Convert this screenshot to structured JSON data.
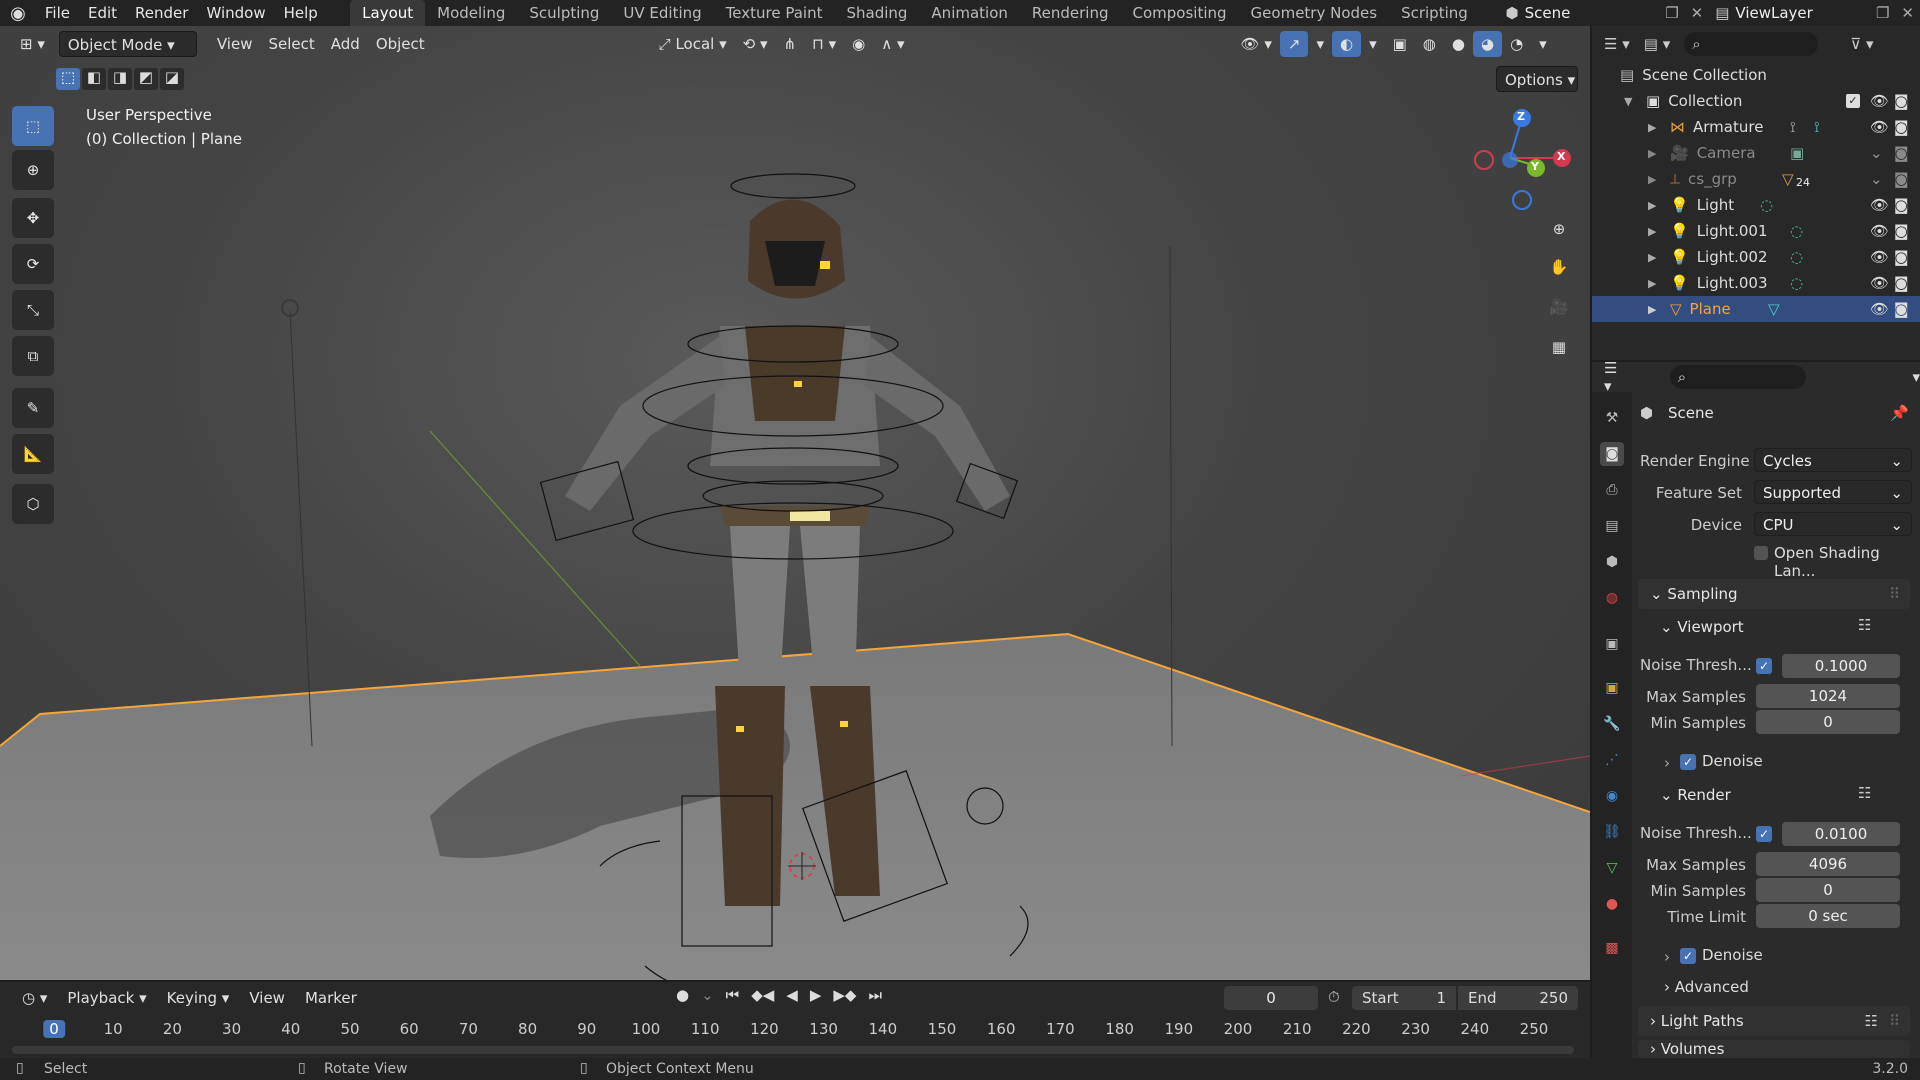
{
  "topbar": {
    "menus": [
      "File",
      "Edit",
      "Render",
      "Window",
      "Help"
    ],
    "workspaces": [
      "Layout",
      "Modeling",
      "Sculpting",
      "UV Editing",
      "Texture Paint",
      "Shading",
      "Animation",
      "Rendering",
      "Compositing",
      "Geometry Nodes",
      "Scripting"
    ],
    "active_workspace": "Layout",
    "scene": "Scene",
    "view_layer": "ViewLayer"
  },
  "viewport_header": {
    "mode": "Object Mode",
    "menus": [
      "View",
      "Select",
      "Add",
      "Object"
    ],
    "transform_orientation": "Local",
    "options": "Options"
  },
  "viewport": {
    "perspective": "User Perspective",
    "context": "(0) Collection | Plane",
    "gizmo_axes": {
      "z": "Z",
      "y": "Y",
      "x": "X"
    },
    "colors": {
      "selected": "#f5a53a",
      "x_axis": "#d43a4f",
      "y_axis": "#7ab92c",
      "z_axis": "#3a7ae0"
    }
  },
  "outliner": {
    "scene_collection": "Scene Collection",
    "collection": "Collection",
    "items": [
      {
        "name": "Armature",
        "selected": false
      },
      {
        "name": "Camera",
        "selected": false
      },
      {
        "name": "cs_grp",
        "badge": "24",
        "selected": false
      },
      {
        "name": "Light",
        "selected": false
      },
      {
        "name": "Light.001",
        "selected": false
      },
      {
        "name": "Light.002",
        "selected": false
      },
      {
        "name": "Light.003",
        "selected": false
      },
      {
        "name": "Plane",
        "selected": true
      }
    ]
  },
  "properties": {
    "context": "Scene",
    "render_engine_label": "Render Engine",
    "render_engine": "Cycles",
    "feature_set_label": "Feature Set",
    "feature_set": "Supported",
    "device_label": "Device",
    "device": "CPU",
    "osl_label": "Open Shading Lan...",
    "sampling": "Sampling",
    "viewport_sub": "Viewport",
    "vp_noise_label": "Noise Thresh...",
    "vp_noise": "0.1000",
    "vp_max_label": "Max Samples",
    "vp_max": "1024",
    "vp_min_label": "Min Samples",
    "vp_min": "0",
    "denoise_label": "Denoise",
    "render_sub": "Render",
    "r_noise_label": "Noise Thresh...",
    "r_noise": "0.0100",
    "r_max_label": "Max Samples",
    "r_max": "4096",
    "r_min_label": "Min Samples",
    "r_min": "0",
    "time_limit_label": "Time Limit",
    "time_limit": "0 sec",
    "advanced": "Advanced",
    "light_paths": "Light Paths",
    "volumes": "Volumes"
  },
  "timeline": {
    "menus": [
      "Playback",
      "Keying",
      "View",
      "Marker"
    ],
    "current_frame": "0",
    "start_label": "Start",
    "start": "1",
    "end_label": "End",
    "end": "250",
    "ruler": [
      "0",
      "10",
      "20",
      "30",
      "40",
      "50",
      "60",
      "70",
      "80",
      "90",
      "100",
      "110",
      "120",
      "130",
      "140",
      "150",
      "160",
      "170",
      "180",
      "190",
      "200",
      "210",
      "220",
      "230",
      "240",
      "250"
    ]
  },
  "statusbar": {
    "select": "Select",
    "rotate": "Rotate View",
    "context_menu": "Object Context Menu",
    "version": "3.2.0"
  }
}
